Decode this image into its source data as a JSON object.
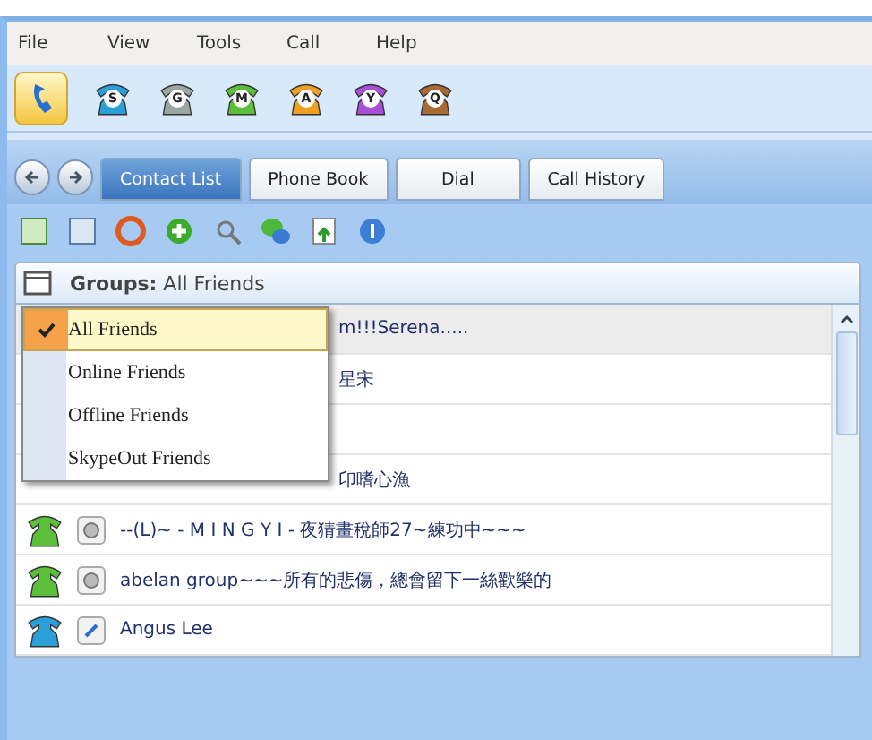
{
  "menu": [
    "File",
    "View",
    "Tools",
    "Call",
    "Help"
  ],
  "phones": [
    {
      "letter": "S",
      "color": "#2a9fd8"
    },
    {
      "letter": "G",
      "color": "#9aa7a0"
    },
    {
      "letter": "M",
      "color": "#5cbf3a"
    },
    {
      "letter": "A",
      "color": "#f0a020"
    },
    {
      "letter": "Y",
      "color": "#a84fd8"
    },
    {
      "letter": "Q",
      "color": "#a86a30"
    }
  ],
  "tabs": [
    {
      "label": "Contact List",
      "selected": true
    },
    {
      "label": "Phone Book",
      "selected": false
    },
    {
      "label": "Dial",
      "selected": false
    },
    {
      "label": "Call History",
      "selected": false
    }
  ],
  "groups": {
    "label": "Groups:",
    "value": "All Friends"
  },
  "group_menu": [
    {
      "label": "All Friends",
      "selected": true
    },
    {
      "label": "Online Friends",
      "selected": false
    },
    {
      "label": "Offline Friends",
      "selected": false
    },
    {
      "label": "SkypeOut Friends",
      "selected": false
    }
  ],
  "contacts": [
    {
      "name": "m!!!Serena.....",
      "selected": true
    },
    {
      "name": "星宋",
      "selected": false
    },
    {
      "selected": false
    },
    {
      "name": "卬嗜心漁",
      "selected": false
    },
    {
      "name": "--(L)~ - M I N G Y I - 夜猜畫稅師27~練功中~~~",
      "color": "#5cbf3a",
      "kind": "offline",
      "selected": false
    },
    {
      "name": "abelan group~~~所有的悲傷，總會留下一絲歡樂的",
      "color": "#5cbf3a",
      "kind": "offline",
      "selected": false
    },
    {
      "name": "Angus Lee",
      "color": "#2a9fd8",
      "kind": "skypeout",
      "selected": false
    }
  ]
}
